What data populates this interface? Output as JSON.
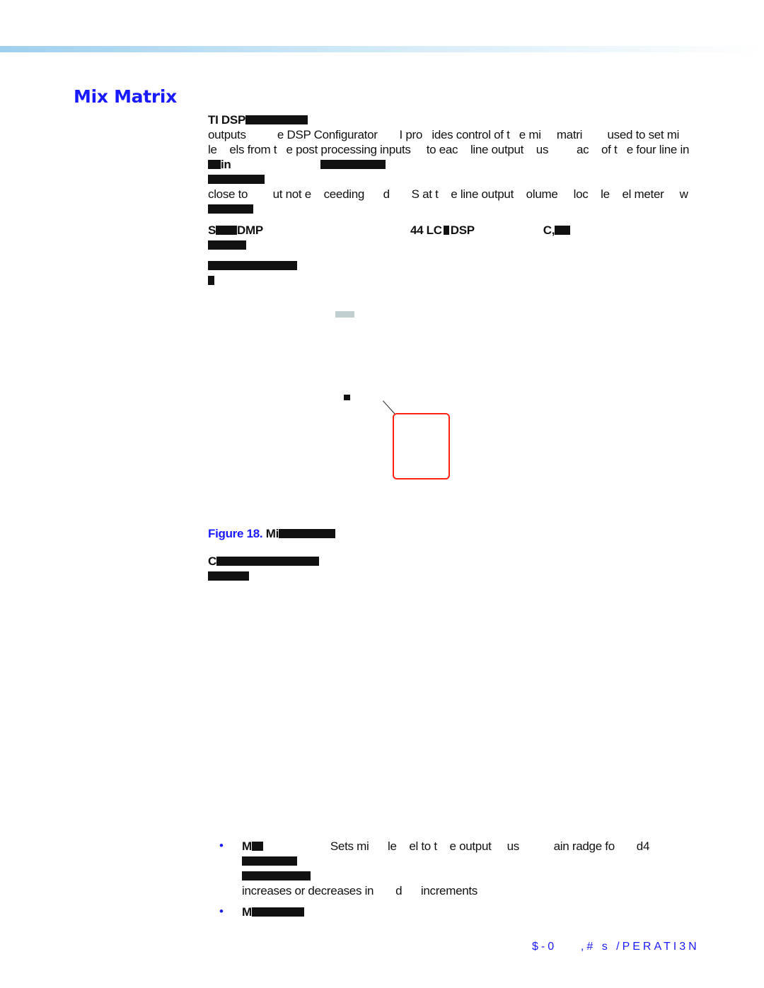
{
  "section_title": "Mix Matrix",
  "paragraph1": {
    "line1_prefix": "TI DSP",
    "line2": "outputs          e DSP Configurator       I pro   ides control of t   e mi     matri        used to set mi",
    "line3": "le    els from t   e post processing inputs     to eac    line output    us         ac    of t   e four line in",
    "line4_prefix": "in",
    "line6": "close to        ut not e    ceeding      d       S at t    e line output    olume     loc    le    el meter     w"
  },
  "paragraph2": {
    "line1_a": "S",
    "line1_b": "DMP",
    "line1_c": "44 LC",
    "line1_d": "DSP",
    "line1_e": "C,"
  },
  "figure": {
    "caption_label": "Figure 18.",
    "caption_prefix": "Mi",
    "callout_color": "#ff2211"
  },
  "paragraph4": {
    "prefix": "C"
  },
  "bullets": [
    {
      "prefix": "M",
      "line1": "Sets mi      le    el to t    e output     us           ain radge fo       d4",
      "line4": "increases or decreases in       d      increments"
    },
    {
      "prefix": "M"
    }
  ],
  "footer": "$-0    ,# s /PERATI3N",
  "colors": {
    "accent": "#1a1aff",
    "band": "#9fd0ee"
  }
}
